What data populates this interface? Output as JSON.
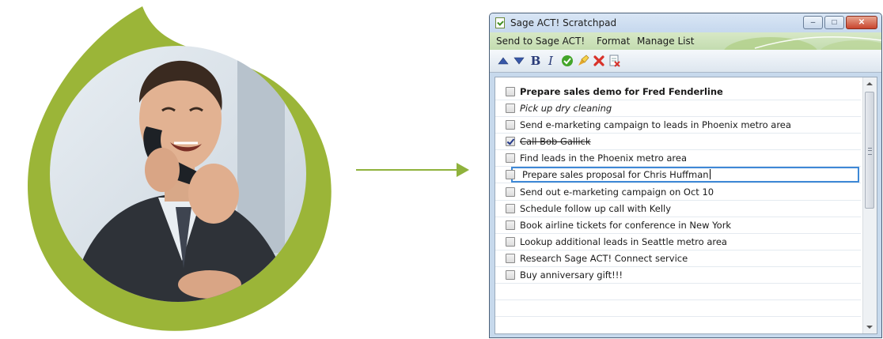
{
  "window": {
    "title": "Sage ACT! Scratchpad",
    "minimize_label": "–",
    "maximize_label": "□",
    "close_label": "✕"
  },
  "menu": {
    "items": [
      {
        "label": "Send to Sage ACT!"
      },
      {
        "label": "Format"
      },
      {
        "label": "Manage List"
      }
    ]
  },
  "toolbar": {
    "buttons": [
      {
        "icon": "move-up-icon"
      },
      {
        "icon": "move-down-icon"
      },
      {
        "icon": "bold-icon",
        "label": "B"
      },
      {
        "icon": "italic-icon",
        "label": "I"
      },
      {
        "icon": "complete-check-icon"
      },
      {
        "icon": "highlight-icon"
      },
      {
        "icon": "delete-icon"
      },
      {
        "icon": "clear-completed-icon"
      }
    ]
  },
  "tasks": [
    {
      "text": "Prepare sales demo for Fred Fenderline",
      "checked": false,
      "style": "bold"
    },
    {
      "text": "Pick up dry cleaning",
      "checked": false,
      "style": "italic"
    },
    {
      "text": "Send e-marketing campaign to leads in Phoenix metro area",
      "checked": false,
      "style": "normal"
    },
    {
      "text": "Call Bob Gallick",
      "checked": true,
      "style": "strike"
    },
    {
      "text": "Find leads in the Phoenix metro area",
      "checked": false,
      "style": "normal"
    },
    {
      "text": "Prepare sales proposal for Chris Huffman",
      "checked": false,
      "style": "editing"
    },
    {
      "text": "Send out e-marketing campaign on Oct 10",
      "checked": false,
      "style": "normal"
    },
    {
      "text": "Schedule follow up call with Kelly",
      "checked": false,
      "style": "normal"
    },
    {
      "text": "Book airline tickets for conference in New York",
      "checked": false,
      "style": "normal"
    },
    {
      "text": "Lookup additional leads in Seattle  metro area",
      "checked": false,
      "style": "normal"
    },
    {
      "text": "Research Sage ACT! Connect service",
      "checked": false,
      "style": "normal"
    },
    {
      "text": "Buy anniversary gift!!!",
      "checked": false,
      "style": "normal"
    }
  ],
  "colors": {
    "accent_green": "#9bb538",
    "arrow_green": "#8fb23c",
    "window_frame": "#c7d9ec"
  }
}
